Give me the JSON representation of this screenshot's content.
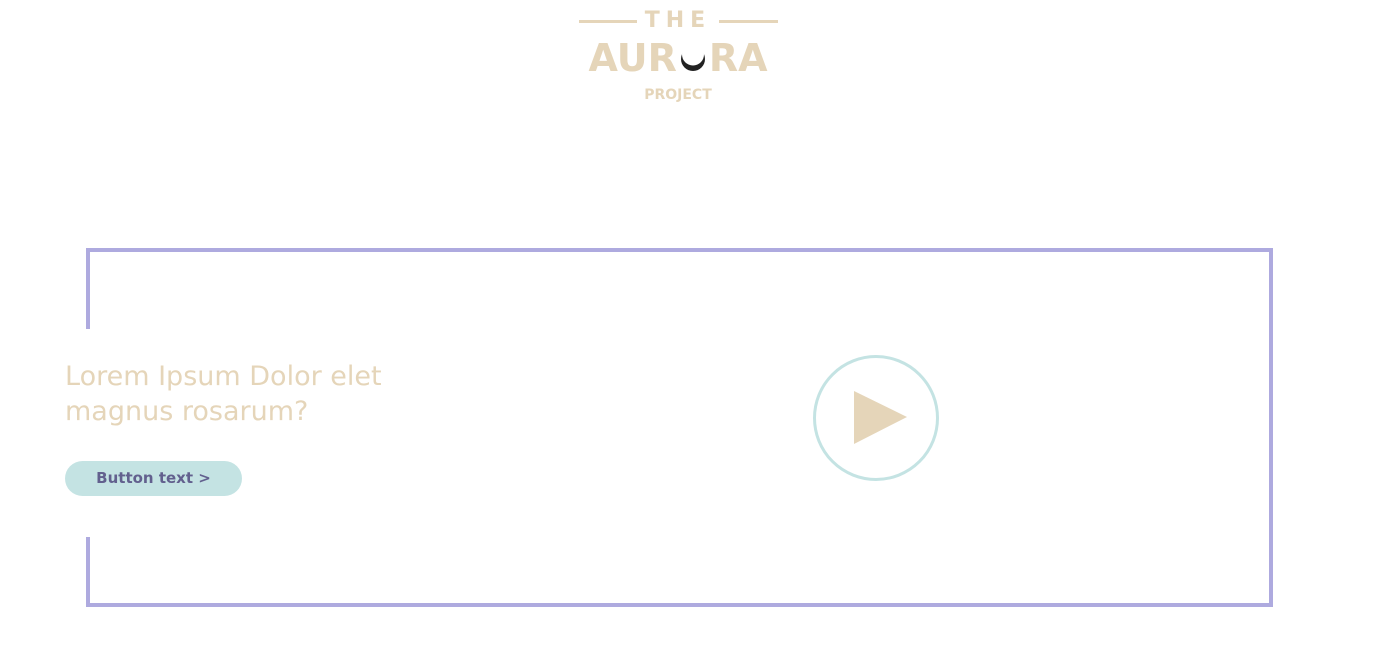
{
  "logo": {
    "the": "THE",
    "main_left": "AUR",
    "main_right": "RA",
    "project": "PROJECT",
    "color": "#e5d5b9",
    "moon_icon": "crescent-moon-icon"
  },
  "hero": {
    "headline": "Lorem Ipsum Dolor elet magnus rosarum?",
    "button_label": "Button text >",
    "headline_color": "#e5d5b9",
    "button_bg": "#c4e3e3",
    "button_text_color": "#62608e",
    "frame_color": "#aeaadf"
  },
  "video": {
    "play_icon": "play-icon",
    "ring_color": "#c4e3e3",
    "triangle_color": "#e5d5b9"
  }
}
